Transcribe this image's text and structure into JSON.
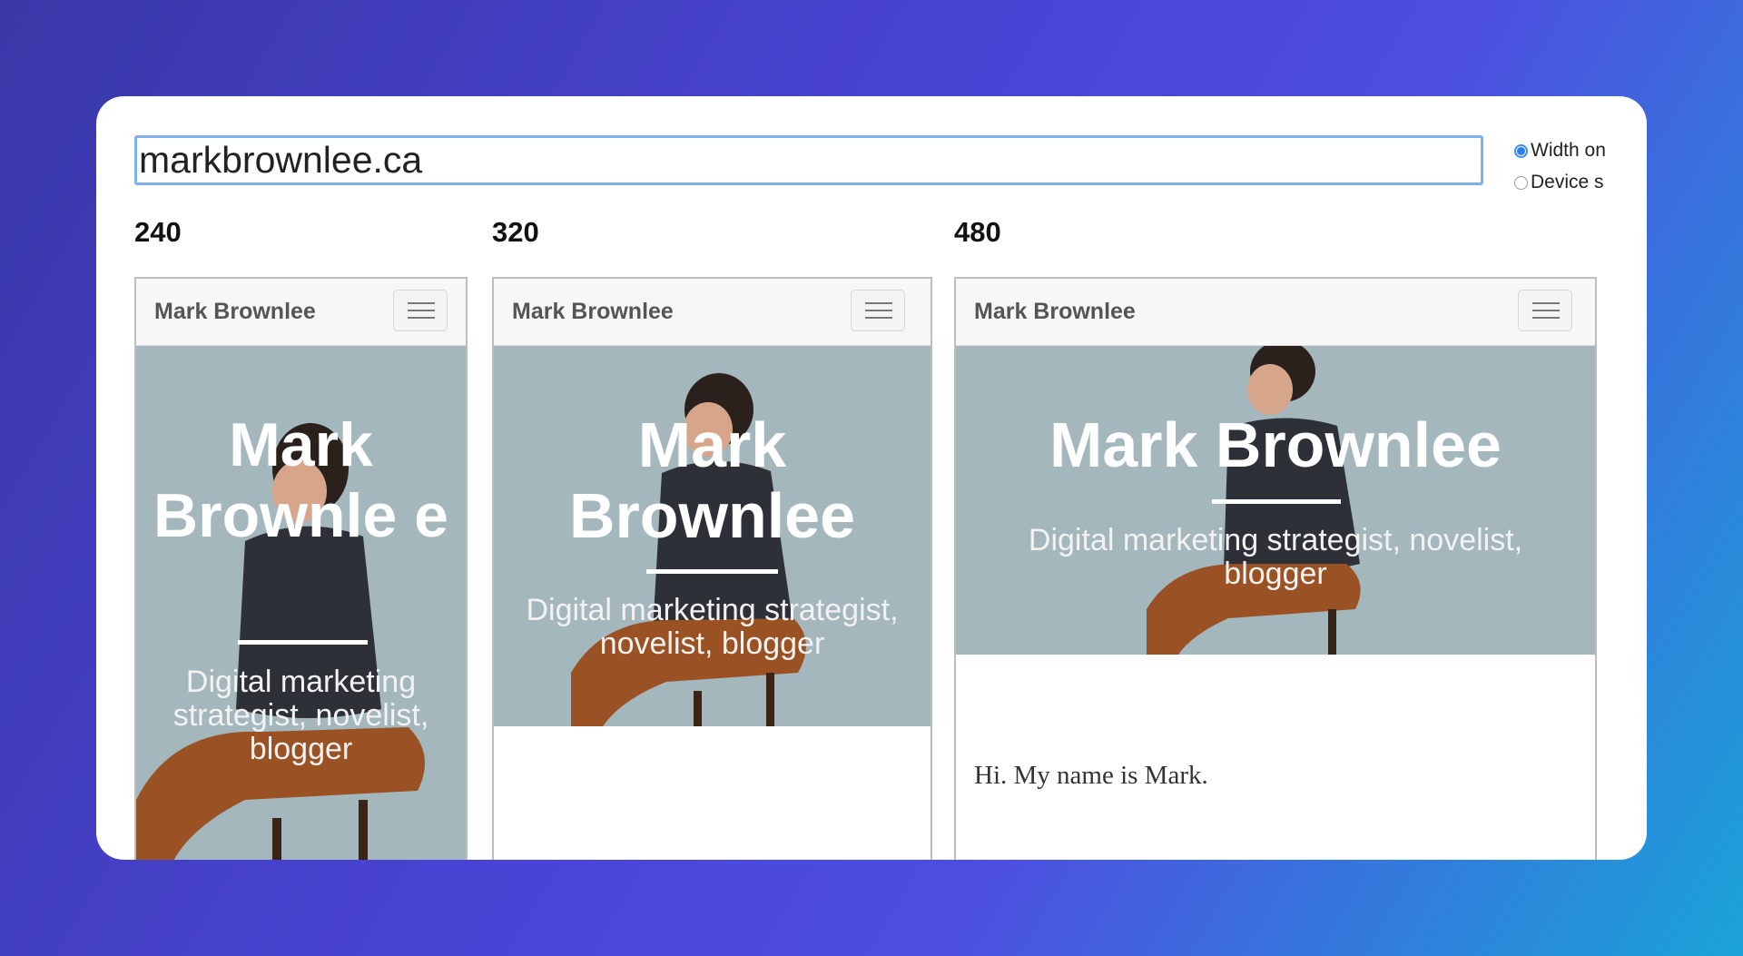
{
  "search": {
    "value": "markbrownlee.ca"
  },
  "options": {
    "width_only": "Width on",
    "device_size": "Device s"
  },
  "viewports": [
    {
      "width_label": "240",
      "brand": "Mark Brownlee",
      "title": "Mark Brownle e",
      "subtitle": "Digital marketing strategist, novelist, blogger"
    },
    {
      "width_label": "320",
      "brand": "Mark Brownlee",
      "title": "Mark Brownlee",
      "subtitle": "Digital marketing strategist, novelist, blogger"
    },
    {
      "width_label": "480",
      "brand": "Mark Brownlee",
      "title": "Mark Brownlee",
      "subtitle": "Digital marketing strategist, novelist, blogger",
      "intro": "Hi. My name is Mark."
    }
  ],
  "colors": {
    "hero_bg": "#a3b7bd",
    "accent": "#2a80ee"
  }
}
